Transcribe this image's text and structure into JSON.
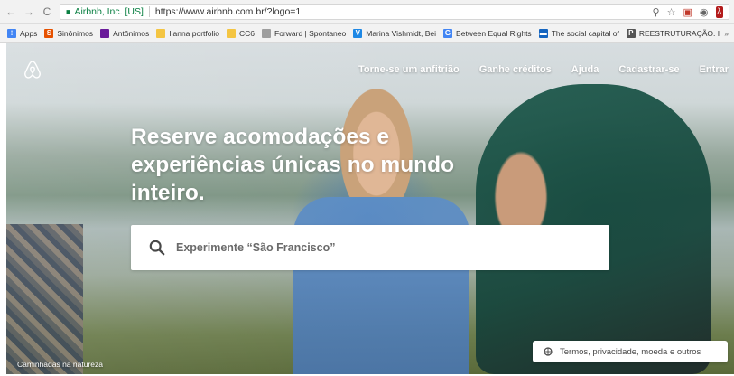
{
  "browser": {
    "back": "←",
    "forward": "→",
    "reload": "C",
    "site_identity": "Airbnb, Inc. [US]",
    "url": "https://www.airbnb.com.br/?logo=1",
    "icons": [
      "zoom-icon",
      "star-icon",
      "extension-icon",
      "camera-icon",
      "pdf-icon"
    ]
  },
  "bookmarks": [
    {
      "label": "Apps",
      "icon": "apps-icon",
      "color": "#4285f4"
    },
    {
      "label": "Sinônimos",
      "icon": "s-icon",
      "color": "#e65100"
    },
    {
      "label": "Antônimos",
      "icon": "square-icon",
      "color": "#6a1b9a"
    },
    {
      "label": "Ilanna portfolio",
      "icon": "folder-icon",
      "color": "#f4c542"
    },
    {
      "label": "CC6",
      "icon": "folder-icon",
      "color": "#f4c542"
    },
    {
      "label": "Forward | Spontaneo",
      "icon": "page-icon",
      "color": "#9e9e9e"
    },
    {
      "label": "Marina Vishmidt, Bei",
      "icon": "v-icon",
      "color": "#1e88e5"
    },
    {
      "label": "Between Equal Rights",
      "icon": "g-icon",
      "color": "#4285f4"
    },
    {
      "label": "The social capital of",
      "icon": "image-icon",
      "color": "#1565c0"
    },
    {
      "label": "REESTRUTURAÇÃO. I",
      "icon": "pdf-icon",
      "color": "#555555"
    }
  ],
  "bookmarks_more": "»",
  "hero": {
    "nav": [
      "Torne-se um anfitrião",
      "Ganhe créditos",
      "Ajuda",
      "Cadastrar-se",
      "Entrar"
    ],
    "headline": "Reserve acomodações e experiências únicas no mundo inteiro.",
    "search_placeholder": "Experimente “São Francisco”",
    "caption": "Caminhadas na natureza",
    "footer_link": "Termos, privacidade, moeda e outros"
  },
  "colors": {
    "site_green": "#0b8043",
    "brand_white": "#ffffff"
  }
}
